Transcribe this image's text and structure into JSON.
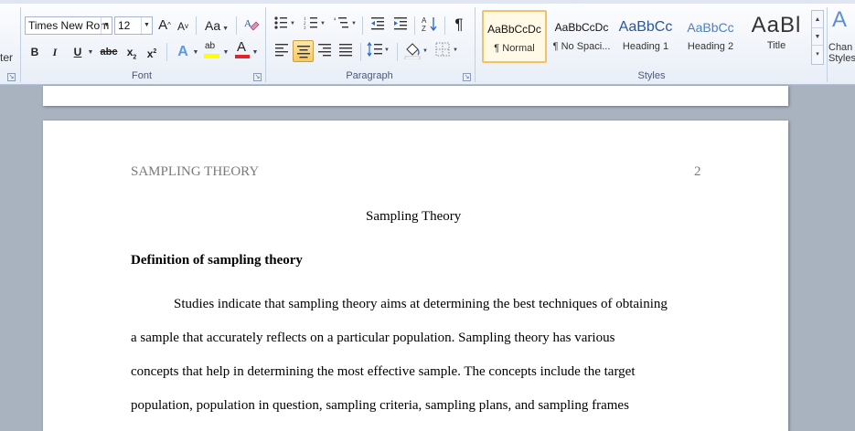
{
  "ribbon": {
    "left_clip_label": "ter",
    "font_group": {
      "label": "Font",
      "font_name": "Times New Rom",
      "font_size": "12",
      "grow_font": "A",
      "shrink_font": "A",
      "change_case": "Aa",
      "bold": "B",
      "italic": "I",
      "underline": "U",
      "strikethrough": "abc",
      "subscript": "x",
      "superscript": "x",
      "highlight_letters": "ab",
      "font_color_letter": "A",
      "text_effects_letter": "A"
    },
    "paragraph_group": {
      "label": "Paragraph",
      "pilcrow": "¶"
    },
    "styles_group": {
      "label": "Styles",
      "tiles": [
        {
          "sample": "AaBbCcDc",
          "name": "¶ Normal",
          "selected": true
        },
        {
          "sample": "AaBbCcDc",
          "name": "¶ No Spaci...",
          "selected": false
        },
        {
          "sample": "AaBbCc",
          "name": "Heading 1",
          "selected": false
        },
        {
          "sample": "AaBbCc",
          "name": "Heading 2",
          "selected": false
        },
        {
          "sample": "AaBl",
          "name": "Title",
          "selected": false
        }
      ],
      "change_styles_line1": "Chan",
      "change_styles_line2": "Styles"
    }
  },
  "document": {
    "running_head": "SAMPLING THEORY",
    "page_number": "2",
    "title": "Sampling Theory",
    "heading": "Definition of sampling theory",
    "paragraph_lines": [
      "Studies indicate that sampling theory aims at determining the best techniques of obtaining",
      "a sample that accurately reflects on a particular population. Sampling theory has various",
      "concepts that help in determining the most effective sample. The concepts include the target",
      "population, population in question, sampling criteria, sampling plans, and sampling frames"
    ]
  },
  "colors": {
    "ribbon_bg": "#e8eef7",
    "doc_bg": "#a9b2bf",
    "selected_style": "#f0c36a",
    "heading_blue": "#2b579a",
    "running_head_gray": "#7a7a7a"
  }
}
